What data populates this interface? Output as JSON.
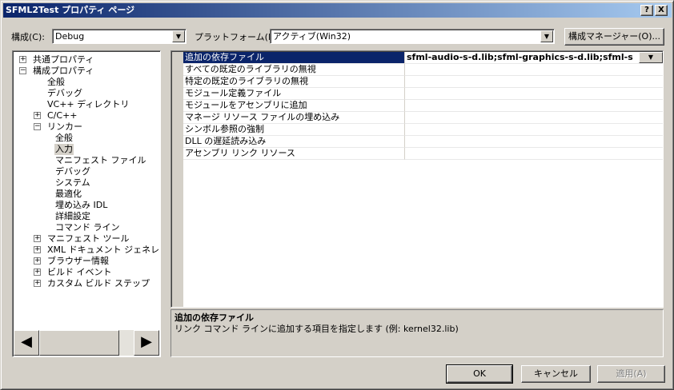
{
  "window": {
    "title": "SFML2Test プロパティ ページ",
    "help_button": "?",
    "close_button": "X"
  },
  "toolbar": {
    "config_label": "構成(C):",
    "config_value": "Debug",
    "platform_label": "プラットフォーム(P):",
    "platform_value": "アクティブ(Win32)",
    "config_manager_button": "構成マネージャー(O)..."
  },
  "tree": {
    "items": [
      {
        "label": "共通プロパティ",
        "expander": "+",
        "level": 0
      },
      {
        "label": "構成プロパティ",
        "expander": "−",
        "level": 0
      },
      {
        "label": "全般",
        "expander": "",
        "level": 1
      },
      {
        "label": "デバッグ",
        "expander": "",
        "level": 1
      },
      {
        "label": "VC++ ディレクトリ",
        "expander": "",
        "level": 1
      },
      {
        "label": "C/C++",
        "expander": "+",
        "level": 1
      },
      {
        "label": "リンカー",
        "expander": "−",
        "level": 1
      },
      {
        "label": "全般",
        "expander": "",
        "level": 2
      },
      {
        "label": "入力",
        "expander": "",
        "level": 2,
        "selected": true
      },
      {
        "label": "マニフェスト ファイル",
        "expander": "",
        "level": 2
      },
      {
        "label": "デバッグ",
        "expander": "",
        "level": 2
      },
      {
        "label": "システム",
        "expander": "",
        "level": 2
      },
      {
        "label": "最適化",
        "expander": "",
        "level": 2
      },
      {
        "label": "埋め込み IDL",
        "expander": "",
        "level": 2
      },
      {
        "label": "詳細設定",
        "expander": "",
        "level": 2
      },
      {
        "label": "コマンド ライン",
        "expander": "",
        "level": 2
      },
      {
        "label": "マニフェスト ツール",
        "expander": "+",
        "level": 1
      },
      {
        "label": "XML ドキュメント ジェネレーター",
        "expander": "+",
        "level": 1
      },
      {
        "label": "ブラウザー情報",
        "expander": "+",
        "level": 1
      },
      {
        "label": "ビルド イベント",
        "expander": "+",
        "level": 1
      },
      {
        "label": "カスタム ビルド ステップ",
        "expander": "+",
        "level": 1
      }
    ],
    "scroll_left": "◀",
    "scroll_right": "▶"
  },
  "grid": {
    "rows": [
      {
        "name": "追加の依存ファイル",
        "value": "sfml-audio-s-d.lib;sfml-graphics-s-d.lib;sfml-s",
        "selected": true
      },
      {
        "name": "すべての既定のライブラリの無視",
        "value": ""
      },
      {
        "name": "特定の既定のライブラリの無視",
        "value": ""
      },
      {
        "name": "モジュール定義ファイル",
        "value": ""
      },
      {
        "name": "モジュールをアセンブリに追加",
        "value": ""
      },
      {
        "name": "マネージ リソース ファイルの埋め込み",
        "value": ""
      },
      {
        "name": "シンボル参照の強制",
        "value": ""
      },
      {
        "name": "DLL の遅延読み込み",
        "value": ""
      },
      {
        "name": "アセンブリ リンク リソース",
        "value": ""
      }
    ]
  },
  "description": {
    "title": "追加の依存ファイル",
    "text": "リンク コマンド ラインに追加する項目を指定します (例: kernel32.lib)"
  },
  "buttons": {
    "ok": "OK",
    "cancel": "キャンセル",
    "apply": "適用(A)"
  },
  "icons": {
    "dropdown": "▼"
  }
}
